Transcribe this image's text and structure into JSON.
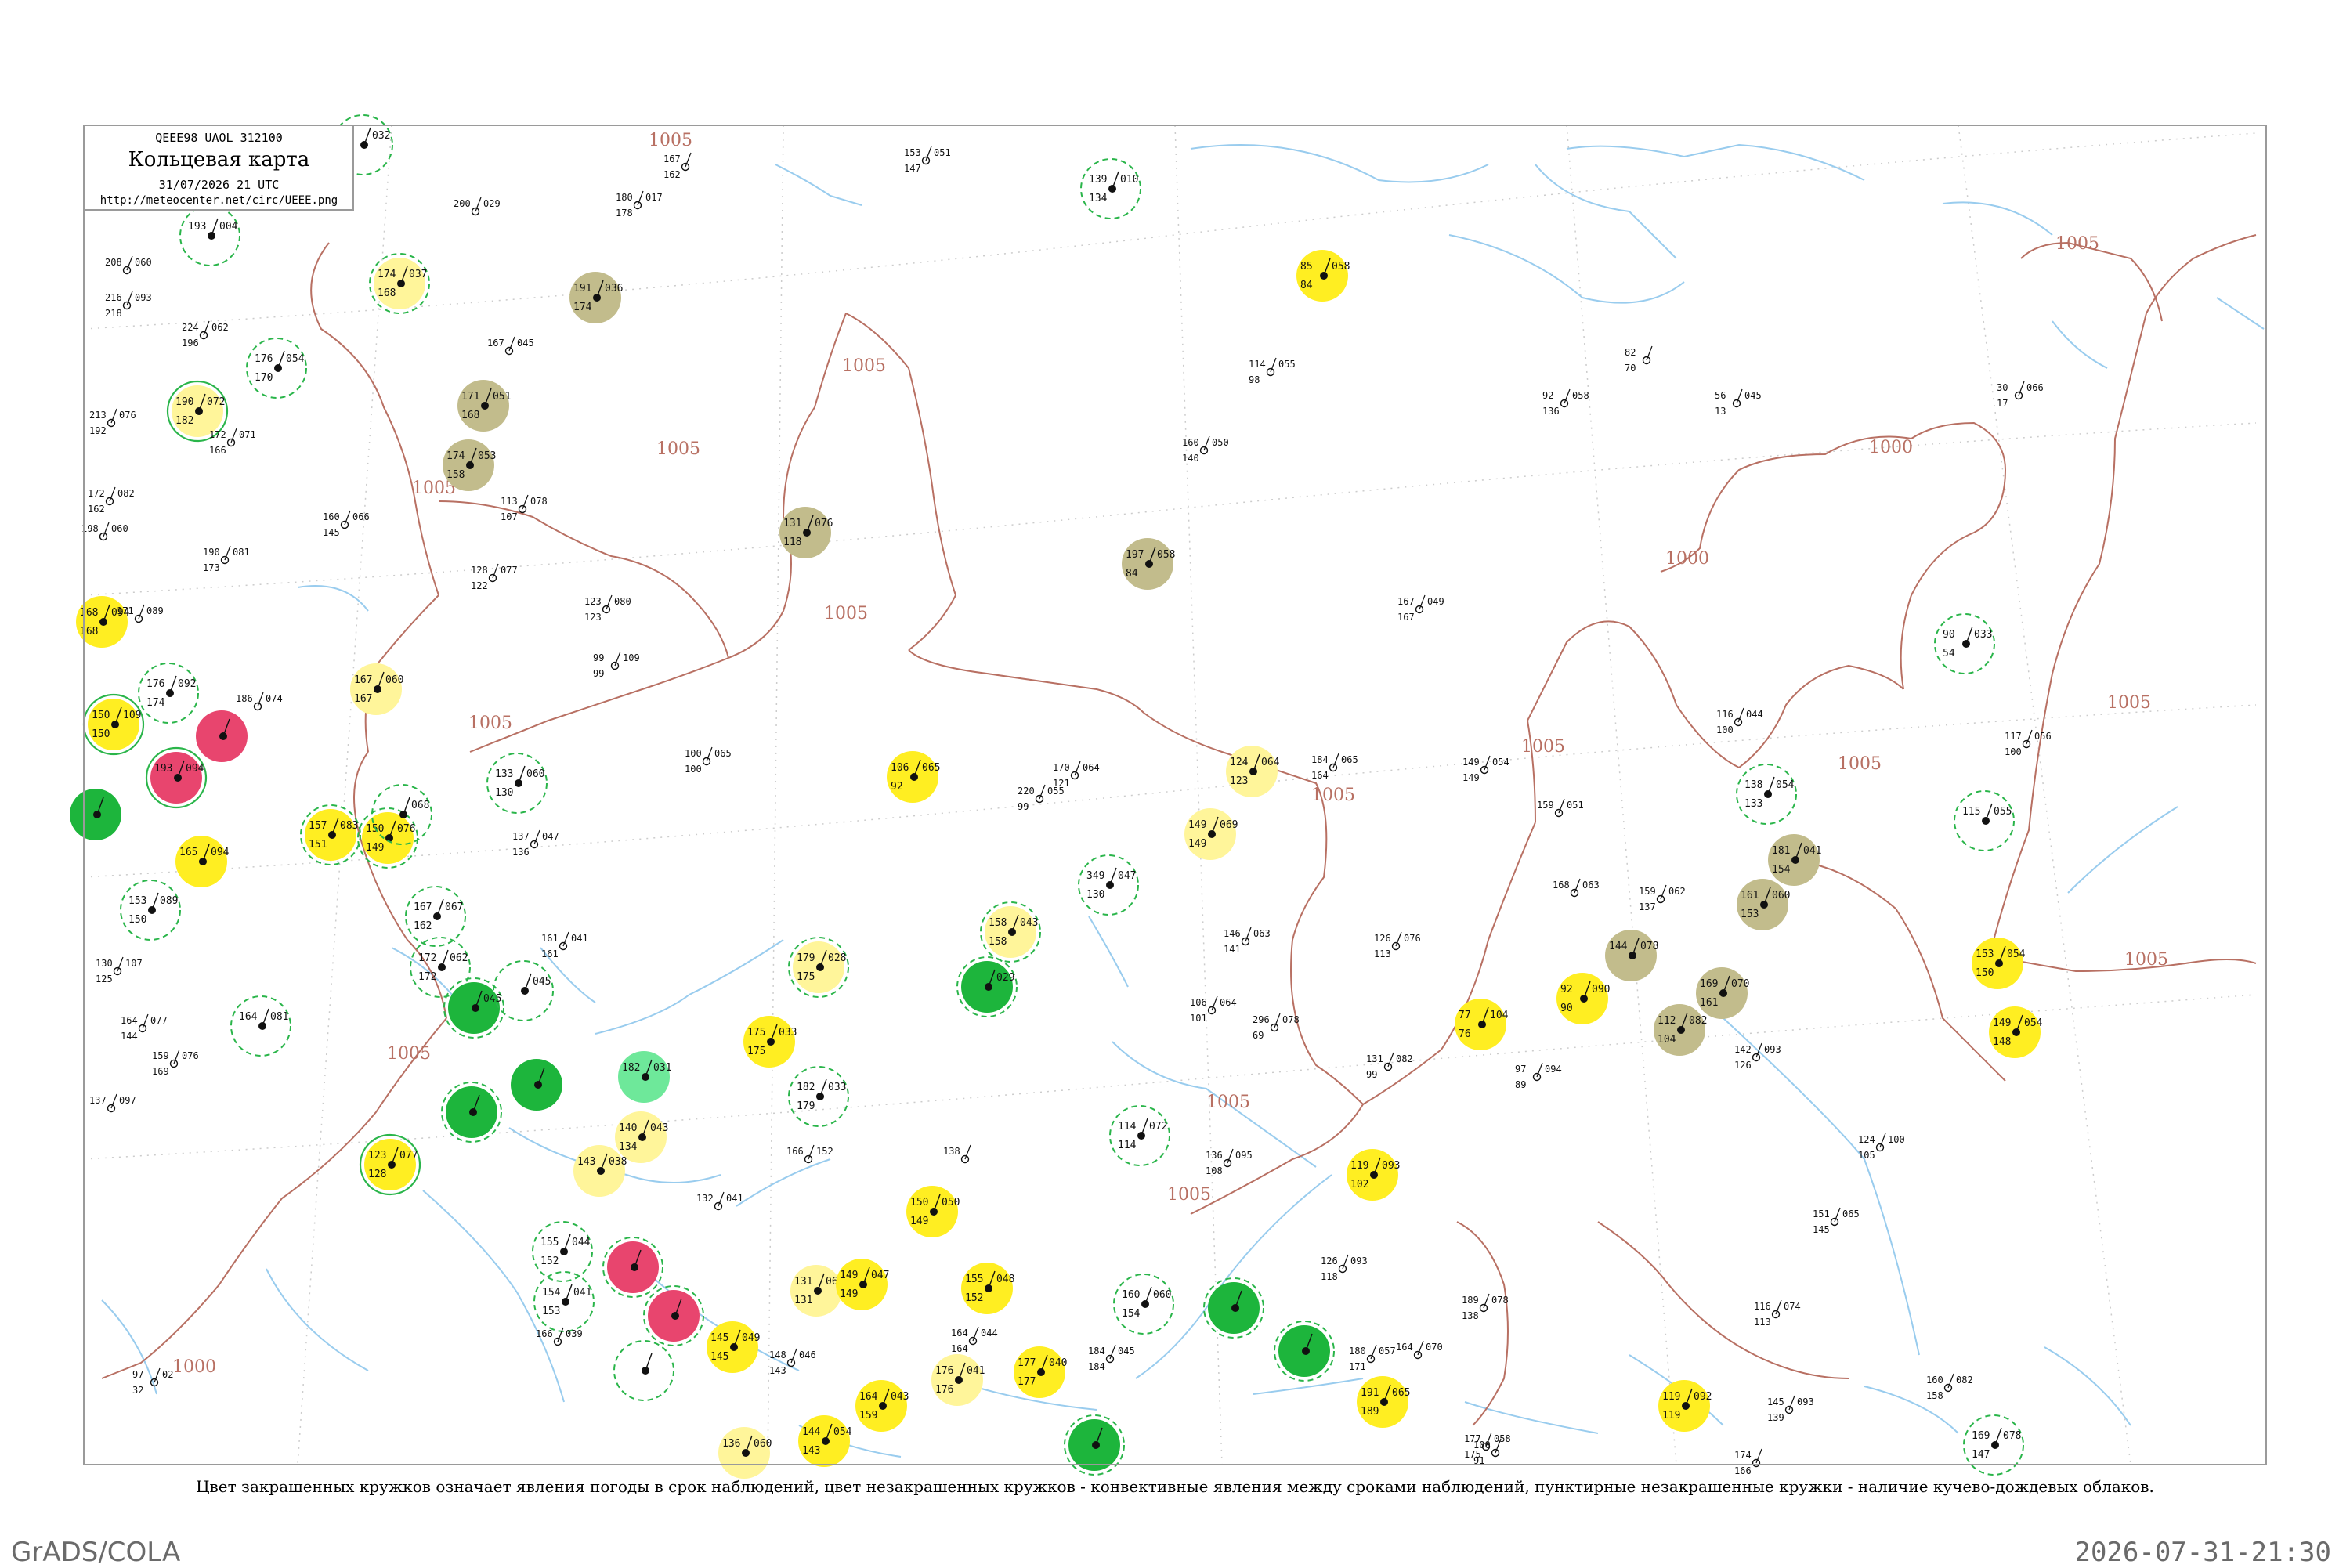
{
  "header": {
    "code": "QEEE98  UAOL  312100",
    "title": "Кольцевая карта",
    "date": "31/07/2026 21 UTC",
    "url": "http://meteocenter.net/circ/UEEE.png"
  },
  "caption": "Цвет закрашенных кружков означает явления погоды в срок наблюдений, цвет незакрашенных кружков - конвективные явления между сроками наблюдений, пунктирные незакрашенные кружки - наличие кучево-дождевых облаков.",
  "footer": {
    "left": "GrADS/COLA",
    "right": "2026-07-31-21:30"
  },
  "colors": {
    "frame": "#9a9a9a",
    "coast": "#99ccee",
    "isobar": "#b87063",
    "grid": "#cccccc",
    "green": "#1db53c",
    "light_green": "#6ee89a",
    "yellow": "#ffee22",
    "pale_yellow": "#fff59a",
    "olive": "#c2bc8c",
    "red": "#e8456e",
    "ring_green": "#2ab54a",
    "station_text": "#111111",
    "station_name": "#777777"
  },
  "isobars": [
    "1005",
    "1005",
    "1005",
    "1005",
    "1005",
    "1005",
    "1005",
    "1005",
    "1005",
    "1005",
    "1005",
    "1005",
    "1005",
    "1005",
    "1005",
    "1000",
    "1000",
    "1000"
  ],
  "stations": [
    {
      "cls": "none",
      "ring": "dash",
      "p": "032",
      "t": "",
      "td": ""
    },
    {
      "cls": "none",
      "ring": "dash",
      "t": "193",
      "td": "",
      "p": "004"
    },
    {
      "cls": "pale",
      "ring": "dash",
      "t": "174",
      "td": "168",
      "p": "037"
    },
    {
      "cls": "olive",
      "ring": "none",
      "t": "191",
      "td": "174",
      "p": "036"
    },
    {
      "cls": "none",
      "ring": "dash",
      "t": "139",
      "td": "134",
      "p": "010"
    },
    {
      "cls": "yellow",
      "ring": "none",
      "t": "85",
      "td": "84",
      "p": "058"
    },
    {
      "cls": "none",
      "ring": "dash",
      "t": "176",
      "td": "170",
      "p": "054"
    },
    {
      "cls": "olive",
      "ring": "none",
      "t": "171",
      "td": "168",
      "p": "051"
    },
    {
      "cls": "pale",
      "ring": "solid",
      "t": "190",
      "td": "182",
      "p": "072"
    },
    {
      "cls": "olive",
      "ring": "none",
      "t": "174",
      "td": "158",
      "p": "053"
    },
    {
      "cls": "olive",
      "ring": "none",
      "t": "131",
      "td": "118",
      "p": "076"
    },
    {
      "cls": "olive",
      "ring": "none",
      "t": "197",
      "td": "84",
      "p": "058"
    },
    {
      "cls": "yellow",
      "ring": "none",
      "t": "168",
      "td": "168",
      "p": "094"
    },
    {
      "cls": "none",
      "ring": "dash",
      "t": "90",
      "td": "54",
      "p": "033"
    },
    {
      "cls": "none",
      "ring": "dash",
      "t": "176",
      "td": "174",
      "p": "092"
    },
    {
      "cls": "yellow",
      "ring": "solid",
      "t": "150",
      "td": "150",
      "p": "109"
    },
    {
      "cls": "red",
      "ring": "solid",
      "t": "193",
      "td": "",
      "p": "094"
    },
    {
      "cls": "red",
      "ring": "none",
      "t": "",
      "td": "",
      "p": ""
    },
    {
      "cls": "green",
      "ring": "none",
      "t": "",
      "td": "",
      "p": ""
    },
    {
      "cls": "pale",
      "ring": "none",
      "t": "167",
      "td": "167",
      "p": "060"
    },
    {
      "cls": "none",
      "ring": "dash",
      "t": "133",
      "td": "130",
      "p": "060"
    },
    {
      "cls": "yellow",
      "ring": "none",
      "t": "106",
      "td": "92",
      "p": "065"
    },
    {
      "cls": "pale",
      "ring": "none",
      "t": "124",
      "td": "123",
      "p": "064"
    },
    {
      "cls": "pale",
      "ring": "none",
      "t": "149",
      "td": "149",
      "p": "069"
    },
    {
      "cls": "yellow",
      "ring": "none",
      "t": "165",
      "td": "",
      "p": "094"
    },
    {
      "cls": "yellow",
      "ring": "dash",
      "t": "157",
      "td": "151",
      "p": "083"
    },
    {
      "cls": "yellow",
      "ring": "dash",
      "t": "150",
      "td": "149",
      "p": "076"
    },
    {
      "cls": "none",
      "ring": "dash",
      "t": "",
      "td": "",
      "p": "068"
    },
    {
      "cls": "none",
      "ring": "dash",
      "t": "153",
      "td": "150",
      "p": "089"
    },
    {
      "cls": "none",
      "ring": "dash",
      "t": "138",
      "td": "133",
      "p": "054"
    },
    {
      "cls": "olive",
      "ring": "none",
      "t": "181",
      "td": "154",
      "p": "041"
    },
    {
      "cls": "none",
      "ring": "dash",
      "t": "115",
      "td": "",
      "p": "055"
    },
    {
      "cls": "olive",
      "ring": "none",
      "t": "161",
      "td": "153",
      "p": "060"
    },
    {
      "cls": "none",
      "ring": "dash",
      "t": "349",
      "td": "130",
      "p": "047"
    },
    {
      "cls": "none",
      "ring": "dash",
      "t": "167",
      "td": "162",
      "p": "067"
    },
    {
      "cls": "pale",
      "ring": "dash",
      "t": "179",
      "td": "175",
      "p": "028"
    },
    {
      "cls": "pale",
      "ring": "dash",
      "t": "158",
      "td": "158",
      "p": "043"
    },
    {
      "cls": "green",
      "ring": "dash",
      "t": "",
      "td": "",
      "p": "029"
    },
    {
      "cls": "none",
      "ring": "dash",
      "t": "172",
      "td": "172",
      "p": "062"
    },
    {
      "cls": "green",
      "ring": "dash",
      "t": "",
      "td": "",
      "p": "045"
    },
    {
      "cls": "none",
      "ring": "dash",
      "t": "",
      "td": "",
      "p": "045"
    },
    {
      "cls": "yellow",
      "ring": "none",
      "t": "153",
      "td": "150",
      "p": "054"
    },
    {
      "cls": "olive",
      "ring": "none",
      "t": "144",
      "td": "",
      "p": "078"
    },
    {
      "cls": "olive",
      "ring": "none",
      "t": "169",
      "td": "161",
      "p": "070"
    },
    {
      "cls": "yellow",
      "ring": "none",
      "t": "92",
      "td": "90",
      "p": "090"
    },
    {
      "cls": "yellow",
      "ring": "none",
      "t": "77",
      "td": "76",
      "p": "104"
    },
    {
      "cls": "olive",
      "ring": "none",
      "t": "112",
      "td": "104",
      "p": "082"
    },
    {
      "cls": "yellow",
      "ring": "none",
      "t": "149",
      "td": "148",
      "p": "054"
    },
    {
      "cls": "none",
      "ring": "dash",
      "t": "164",
      "td": "",
      "p": "081"
    },
    {
      "cls": "yellow",
      "ring": "none",
      "t": "175",
      "td": "175",
      "p": "033"
    },
    {
      "cls": "green",
      "ring": "dash",
      "t": "",
      "td": "",
      "p": ""
    },
    {
      "cls": "green",
      "ring": "none",
      "t": "",
      "td": "",
      "p": ""
    },
    {
      "cls": "lightgreen",
      "ring": "none",
      "t": "182",
      "td": "",
      "p": "031"
    },
    {
      "cls": "none",
      "ring": "dash",
      "t": "182",
      "td": "179",
      "p": "033"
    },
    {
      "cls": "pale",
      "ring": "none",
      "t": "140",
      "td": "134",
      "p": "043"
    },
    {
      "cls": "none",
      "ring": "dash",
      "t": "114",
      "td": "114",
      "p": "072"
    },
    {
      "cls": "yellow",
      "ring": "solid",
      "t": "123",
      "td": "128",
      "p": "077"
    },
    {
      "cls": "pale",
      "ring": "none",
      "t": "143",
      "td": "",
      "p": "038"
    },
    {
      "cls": "yellow",
      "ring": "none",
      "t": "119",
      "td": "102",
      "p": "093"
    },
    {
      "cls": "yellow",
      "ring": "none",
      "t": "150",
      "td": "149",
      "p": "050"
    },
    {
      "cls": "none",
      "ring": "dash",
      "t": "155",
      "td": "152",
      "p": "044"
    },
    {
      "cls": "red",
      "ring": "dash",
      "t": "",
      "td": "",
      "p": ""
    },
    {
      "cls": "none",
      "ring": "dash",
      "t": "154",
      "td": "153",
      "p": "041"
    },
    {
      "cls": "red",
      "ring": "dash",
      "t": "",
      "td": "",
      "p": ""
    },
    {
      "cls": "pale",
      "ring": "none",
      "t": "131",
      "td": "131",
      "p": "060"
    },
    {
      "cls": "yellow",
      "ring": "none",
      "t": "149",
      "td": "149",
      "p": "047"
    },
    {
      "cls": "yellow",
      "ring": "none",
      "t": "155",
      "td": "152",
      "p": "048"
    },
    {
      "cls": "none",
      "ring": "dash",
      "t": "160",
      "td": "154",
      "p": "060"
    },
    {
      "cls": "green",
      "ring": "dash",
      "t": "",
      "td": "",
      "p": ""
    },
    {
      "cls": "green",
      "ring": "dash",
      "t": "",
      "td": "",
      "p": ""
    },
    {
      "cls": "yellow",
      "ring": "none",
      "t": "145",
      "td": "145",
      "p": "049"
    },
    {
      "cls": "none",
      "ring": "dash",
      "t": "",
      "td": "",
      "p": ""
    },
    {
      "cls": "yellow",
      "ring": "none",
      "t": "177",
      "td": "177",
      "p": "040"
    },
    {
      "cls": "pale",
      "ring": "none",
      "t": "176",
      "td": "176",
      "p": "041"
    },
    {
      "cls": "yellow",
      "ring": "none",
      "t": "164",
      "td": "159",
      "p": "043"
    },
    {
      "cls": "yellow",
      "ring": "none",
      "t": "191",
      "td": "189",
      "p": "065"
    },
    {
      "cls": "yellow",
      "ring": "none",
      "t": "144",
      "td": "143",
      "p": "054"
    },
    {
      "cls": "pale",
      "ring": "none",
      "t": "136",
      "td": "",
      "p": "060"
    },
    {
      "cls": "green",
      "ring": "dash",
      "t": "",
      "td": "",
      "p": ""
    },
    {
      "cls": "yellow",
      "ring": "none",
      "t": "119",
      "td": "119",
      "p": "092"
    },
    {
      "cls": "none",
      "ring": "dash",
      "t": "169",
      "td": "147",
      "p": "078"
    }
  ],
  "plain_stations": [
    {
      "t": "167",
      "td": "162",
      "p": ""
    },
    {
      "t": "153",
      "td": "147",
      "p": "051"
    },
    {
      "t": "180",
      "td": "178",
      "p": "017"
    },
    {
      "t": "200",
      "td": "",
      "p": "029"
    },
    {
      "t": "208",
      "td": "",
      "p": "060"
    },
    {
      "t": "216",
      "td": "218",
      "p": "093"
    },
    {
      "t": "224",
      "td": "196",
      "p": "062"
    },
    {
      "t": "167",
      "td": "",
      "p": "045"
    },
    {
      "t": "114",
      "td": "98",
      "p": "055"
    },
    {
      "t": "92",
      "td": "136",
      "p": "058"
    },
    {
      "t": "56",
      "td": "13",
      "p": "045"
    },
    {
      "t": "30",
      "td": "17",
      "p": "066"
    },
    {
      "t": "82",
      "td": "70",
      "p": ""
    },
    {
      "t": "213",
      "td": "192",
      "p": "076"
    },
    {
      "t": "172",
      "td": "166",
      "p": "071"
    },
    {
      "t": "160",
      "td": "140",
      "p": "050"
    },
    {
      "t": "172",
      "td": "162",
      "p": "082"
    },
    {
      "t": "160",
      "td": "145",
      "p": "066"
    },
    {
      "t": "113",
      "td": "107",
      "p": "078"
    },
    {
      "t": "198",
      "td": "",
      "p": "060"
    },
    {
      "t": "190",
      "td": "173",
      "p": "081"
    },
    {
      "t": "128",
      "td": "122",
      "p": "077"
    },
    {
      "t": "123",
      "td": "123",
      "p": "080"
    },
    {
      "t": "171",
      "td": "",
      "p": "089"
    },
    {
      "t": "167",
      "td": "167",
      "p": "049"
    },
    {
      "t": "99",
      "td": "99",
      "p": "109"
    },
    {
      "t": "116",
      "td": "100",
      "p": "044"
    },
    {
      "t": "186",
      "td": "",
      "p": "074"
    },
    {
      "t": "117",
      "td": "100",
      "p": "056"
    },
    {
      "t": "100",
      "td": "100",
      "p": "065"
    },
    {
      "t": "170",
      "td": "121",
      "p": "064"
    },
    {
      "t": "220",
      "td": "99",
      "p": "055"
    },
    {
      "t": "184",
      "td": "164",
      "p": "065"
    },
    {
      "t": "149",
      "td": "149",
      "p": "054"
    },
    {
      "t": "159",
      "td": "",
      "p": "051"
    },
    {
      "t": "137",
      "td": "136",
      "p": "047"
    },
    {
      "t": "168",
      "td": "",
      "p": "063"
    },
    {
      "t": "159",
      "td": "137",
      "p": "062"
    },
    {
      "t": "146",
      "td": "141",
      "p": "063"
    },
    {
      "t": "126",
      "td": "113",
      "p": "076"
    },
    {
      "t": "161",
      "td": "161",
      "p": "041"
    },
    {
      "t": "130",
      "td": "125",
      "p": "107"
    },
    {
      "t": "106",
      "td": "101",
      "p": "064"
    },
    {
      "t": "296",
      "td": "69",
      "p": "078"
    },
    {
      "t": "131",
      "td": "99",
      "p": "082"
    },
    {
      "t": "142",
      "td": "126",
      "p": "093"
    },
    {
      "t": "164",
      "td": "144",
      "p": "077"
    },
    {
      "t": "159",
      "td": "169",
      "p": "076"
    },
    {
      "t": "137",
      "td": "",
      "p": "097"
    },
    {
      "t": "97",
      "td": "89",
      "p": "094"
    },
    {
      "t": "138",
      "td": "",
      "p": ""
    },
    {
      "t": "136",
      "td": "108",
      "p": "095"
    },
    {
      "t": "124",
      "td": "105",
      "p": "100"
    },
    {
      "t": "151",
      "td": "145",
      "p": "065"
    },
    {
      "t": "132",
      "td": "",
      "p": "041"
    },
    {
      "t": "166",
      "td": "",
      "p": "152"
    },
    {
      "t": "126",
      "td": "118",
      "p": "093"
    },
    {
      "t": "189",
      "td": "138",
      "p": "078"
    },
    {
      "t": "116",
      "td": "113",
      "p": "074"
    },
    {
      "t": "166",
      "td": "",
      "p": "039"
    },
    {
      "t": "164",
      "td": "164",
      "p": "044"
    },
    {
      "t": "184",
      "td": "184",
      "p": "045"
    },
    {
      "t": "180",
      "td": "171",
      "p": "057"
    },
    {
      "t": "164",
      "td": "",
      "p": "070"
    },
    {
      "t": "148",
      "td": "143",
      "p": "046"
    },
    {
      "t": "160",
      "td": "158",
      "p": "082"
    },
    {
      "t": "177",
      "td": "175",
      "p": "058"
    },
    {
      "t": "100",
      "td": "91",
      "p": ""
    },
    {
      "t": "145",
      "td": "139",
      "p": "093"
    },
    {
      "t": "174",
      "td": "166",
      "p": ""
    },
    {
      "t": "97",
      "td": "32",
      "p": "02"
    }
  ]
}
